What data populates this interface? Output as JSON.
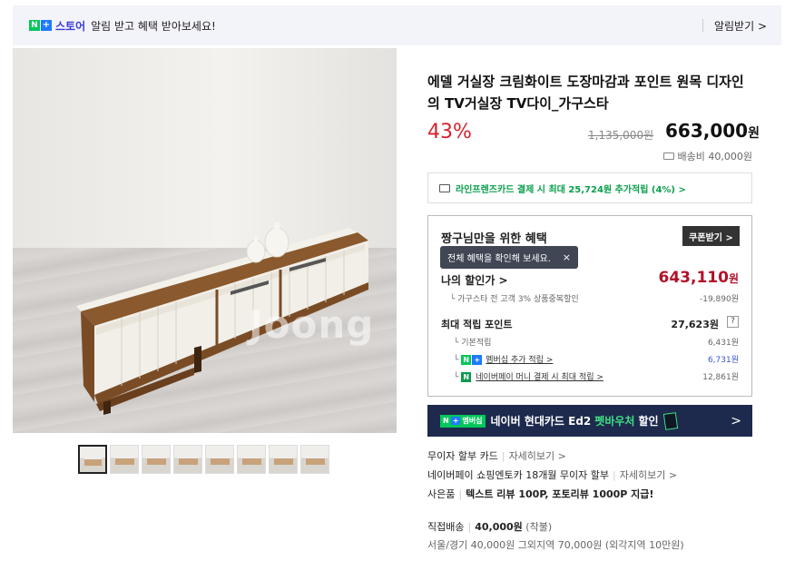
{
  "topbar": {
    "n_mark": "N",
    "plus_mark": "+",
    "store_label": "스토어",
    "message": "알림 받고 혜택 받아보세요!",
    "subscribe_label": "알림받기 >"
  },
  "gallery": {
    "watermark": "Joong",
    "thumbnail_count": 8,
    "selected_thumbnail": 1
  },
  "product": {
    "title": "에델 거실장 크림화이트 도장마감과 포인트 원목 디자인의 TV거실장 TV다이_가구스타",
    "discount": "43%",
    "original_price": "1,135,000원",
    "price": "663,000",
    "price_unit": "원",
    "shipping": "배송비 40,000원"
  },
  "card_promo": "라인프렌즈카드 결제 시 최대 25,724원 추가적립 (4%) >",
  "benefits": {
    "title": "짱구님만을 위한 혜택",
    "coupon_button": "쿠폰받기 >",
    "tooltip": "전체 혜택을 확인해 보세요.",
    "tooltip_close": "×",
    "my_price_label": "나의 할인가 >",
    "my_price": "643,110",
    "my_price_unit": "원",
    "discount_line_label": "가구스타 전 고객 3% 상품중복할인",
    "discount_line_value": "-19,890원",
    "points_label": "최대 적립 포인트",
    "points_value": "27,623원",
    "help": "?",
    "rows": [
      {
        "label": "기본적립",
        "value": "6,431원"
      },
      {
        "label": "멤버십 추가 적립 >",
        "value": "6,731원"
      },
      {
        "label": "네이버페이 머니 결제 시 최대 적립 >",
        "value": "12,861원"
      }
    ]
  },
  "banner": {
    "badge_n": "N",
    "badge_plus": "+",
    "badge_text": "멤버십",
    "text": "네이버 현대카드 Ed2",
    "highlight": "펫바우처",
    "suffix": "할인",
    "arrow": ">"
  },
  "info": {
    "installment": {
      "label": "무이자 할부 카드",
      "link": "자세히보기 >"
    },
    "naverpay": {
      "label": "네이버페이 쇼핑엔토카 18개월 무이자 할부",
      "link": "자세히보기 >"
    },
    "gift": {
      "label": "사은품",
      "text": "텍스트 리뷰 100P, 포토리뷰 1000P 지급!"
    },
    "delivery": {
      "label": "직접배송",
      "price": "40,000원",
      "note": "(착불)"
    },
    "region": "서울/경기 40,000원 그외지역 70,000원 (외각지역 10만원)"
  },
  "colors": {
    "accent_red": "#d5232e",
    "price_red": "#b0122a",
    "naver_green": "#03c75a",
    "banner_navy": "#1d2a4d"
  }
}
